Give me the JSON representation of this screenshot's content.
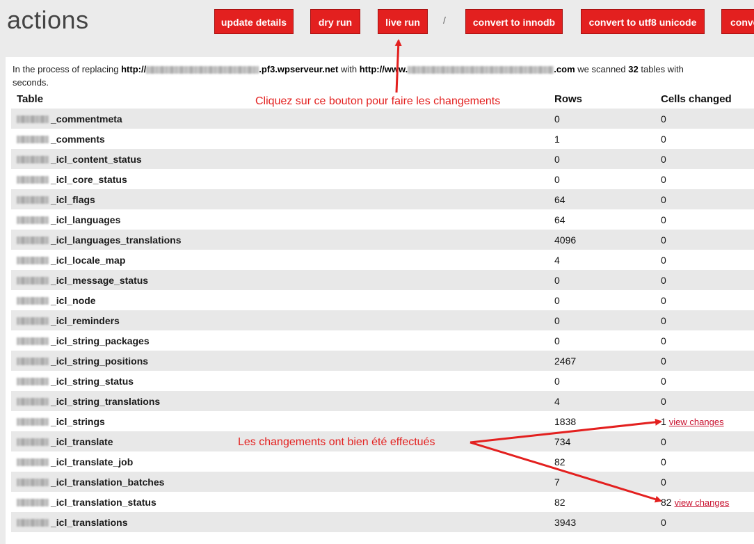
{
  "header": {
    "title": "actions",
    "buttons": [
      {
        "label": "update details"
      },
      {
        "label": "dry run"
      },
      {
        "label": "live run"
      },
      {
        "label": "convert to innodb"
      },
      {
        "label": "convert to utf8 unicode"
      },
      {
        "label": "conve"
      }
    ],
    "separator": "/"
  },
  "summary": {
    "prefix": "In the process of replacing",
    "from_url_start": "http://",
    "from_url_end": ".pf3.wpserveur.net",
    "with_text": "with",
    "to_url_start": "http://www.",
    "to_url_end": ".com",
    "scanned_text": "we scanned",
    "table_count": "32",
    "tables_text": "tables with",
    "seconds_text": "seconds."
  },
  "table": {
    "headers": {
      "table": "Table",
      "rows": "Rows",
      "cells": "Cells changed"
    },
    "rows": [
      {
        "name": "_commentmeta",
        "rows": "0",
        "cells": "0"
      },
      {
        "name": "_comments",
        "rows": "1",
        "cells": "0"
      },
      {
        "name": "_icl_content_status",
        "rows": "0",
        "cells": "0"
      },
      {
        "name": "_icl_core_status",
        "rows": "0",
        "cells": "0"
      },
      {
        "name": "_icl_flags",
        "rows": "64",
        "cells": "0"
      },
      {
        "name": "_icl_languages",
        "rows": "64",
        "cells": "0"
      },
      {
        "name": "_icl_languages_translations",
        "rows": "4096",
        "cells": "0"
      },
      {
        "name": "_icl_locale_map",
        "rows": "4",
        "cells": "0"
      },
      {
        "name": "_icl_message_status",
        "rows": "0",
        "cells": "0"
      },
      {
        "name": "_icl_node",
        "rows": "0",
        "cells": "0"
      },
      {
        "name": "_icl_reminders",
        "rows": "0",
        "cells": "0"
      },
      {
        "name": "_icl_string_packages",
        "rows": "0",
        "cells": "0"
      },
      {
        "name": "_icl_string_positions",
        "rows": "2467",
        "cells": "0"
      },
      {
        "name": "_icl_string_status",
        "rows": "0",
        "cells": "0"
      },
      {
        "name": "_icl_string_translations",
        "rows": "4",
        "cells": "0"
      },
      {
        "name": "_icl_strings",
        "rows": "1838",
        "cells": "1",
        "link": "view changes"
      },
      {
        "name": "_icl_translate",
        "rows": "734",
        "cells": "0"
      },
      {
        "name": "_icl_translate_job",
        "rows": "82",
        "cells": "0"
      },
      {
        "name": "_icl_translation_batches",
        "rows": "7",
        "cells": "0"
      },
      {
        "name": "_icl_translation_status",
        "rows": "82",
        "cells": "82",
        "link": "view changes"
      },
      {
        "name": "_icl_translations",
        "rows": "3943",
        "cells": "0"
      }
    ]
  },
  "annotations": {
    "button_hint": "Cliquez sur ce bouton pour faire les changements",
    "result_hint": "Les changements ont bien  été effectués"
  },
  "colors": {
    "accent": "#e3201f",
    "row_alt": "#e8e8e8"
  }
}
